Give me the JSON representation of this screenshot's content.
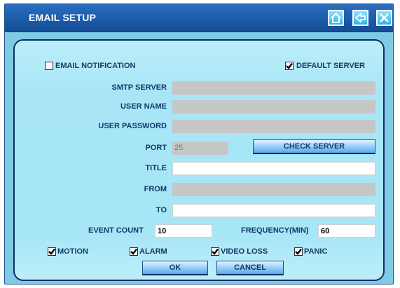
{
  "window": {
    "title": "EMAIL SETUP"
  },
  "titlebar_buttons": [
    {
      "icon": "home-icon"
    },
    {
      "icon": "back-arrow-icon"
    },
    {
      "icon": "close-icon"
    }
  ],
  "email_notification": {
    "label": "EMAIL NOTIFICATION",
    "checked": false
  },
  "default_server": {
    "label": "DEFAULT SERVER",
    "checked": true
  },
  "fields": {
    "smtp_server": {
      "label": "SMTP SERVER",
      "value": ""
    },
    "user_name": {
      "label": "USER NAME",
      "value": ""
    },
    "user_password": {
      "label": "USER PASSWORD",
      "value": ""
    },
    "port": {
      "label": "PORT",
      "value": "25"
    },
    "title": {
      "label": "TITLE",
      "value": ""
    },
    "from": {
      "label": "FROM",
      "value": ""
    },
    "to": {
      "label": "TO",
      "value": ""
    },
    "event_count": {
      "label": "EVENT COUNT",
      "value": "10"
    },
    "frequency": {
      "label": "FREQUENCY(MIN)",
      "value": "60"
    }
  },
  "check_server_label": "CHECK SERVER",
  "events": [
    {
      "label": "MOTION",
      "checked": true
    },
    {
      "label": "ALARM",
      "checked": true
    },
    {
      "label": "VIDEO LOSS",
      "checked": true
    },
    {
      "label": "PANIC",
      "checked": true
    }
  ],
  "ok_label": "OK",
  "cancel_label": "CANCEL",
  "colors": {
    "titlebar": "#1a5aa8",
    "panel": "#a6e6f6",
    "disabled_field": "#c6c6c6",
    "label_text": "#143a6b"
  }
}
